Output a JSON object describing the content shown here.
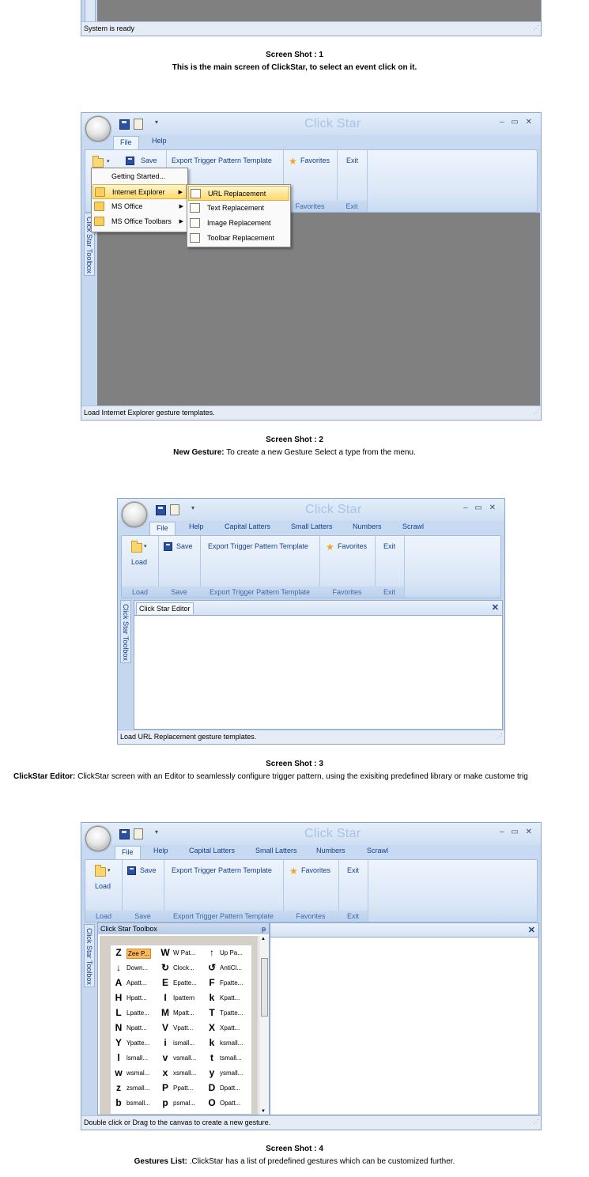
{
  "app": {
    "title": "Click Star",
    "controls": "– ▭ ✕"
  },
  "shot1": {
    "status": "System is ready",
    "caption_title": "Screen Shot : 1",
    "caption_text": "This is the main screen of ClickStar, to select an event click on it."
  },
  "shot2": {
    "tabs": [
      "File",
      "Help"
    ],
    "ribbon": {
      "save": "Save",
      "export": "Export Trigger Pattern Template",
      "favorites": "Favorites",
      "exit": "Exit",
      "group_favorites": "Favorites",
      "group_exit": "Exit"
    },
    "menu": [
      "Getting Started...",
      "Internet Explorer",
      "MS Office",
      "MS Office Toolbars"
    ],
    "submenu": [
      "URL Replacement",
      "Text Replacement",
      "Image Replacement",
      "Toolbar Replacement"
    ],
    "sidetab": "Click Star Toolbox",
    "status": "Load Internet Explorer gesture templates.",
    "caption_title": "Screen Shot : 2",
    "caption_bold": "New Gesture:",
    "caption_text": " To create a new Gesture Select a type from the menu."
  },
  "shot3": {
    "tabs": [
      "File",
      "Help",
      "Capital Latters",
      "Small Latters",
      "Numbers",
      "Scrawl"
    ],
    "ribbon": {
      "load": "Load",
      "save": "Save",
      "export": "Export Trigger Pattern Template",
      "favorites": "Favorites",
      "exit": "Exit",
      "group_load": "Load",
      "group_save": "Save",
      "group_export": "Export Trigger Pattern Template",
      "group_favorites": "Favorites",
      "group_exit": "Exit"
    },
    "sidetab": "Click Star Toolbox",
    "editor_tab": "Click Star Editor",
    "status": "Load URL Replacement gesture templates.",
    "caption_title": "Screen Shot : 3",
    "caption_bold": "ClickStar Editor:",
    "caption_text": " ClickStar screen with an Editor to seamlessly configure trigger pattern, using the exisiting predefined library or make custome trig"
  },
  "shot4": {
    "tabs": [
      "File",
      "Help",
      "Capital Latters",
      "Small Latters",
      "Numbers",
      "Scrawl"
    ],
    "ribbon": {
      "load": "Load",
      "save": "Save",
      "export": "Export Trigger Pattern Template",
      "favorites": "Favorites",
      "exit": "Exit",
      "group_load": "Load",
      "group_save": "Save",
      "group_export": "Export Trigger Pattern Template",
      "group_favorites": "Favorites",
      "group_exit": "Exit"
    },
    "sidetab": "Click Star Toolbox",
    "toolbox_title": "Click Star Toolbox",
    "pin": "ᵽ",
    "gestures": [
      [
        "Z",
        "Zee P..."
      ],
      [
        "W",
        "W Pat..."
      ],
      [
        "↑",
        "Up Pa..."
      ],
      [
        "↓",
        "Down..."
      ],
      [
        "↻",
        "Clock..."
      ],
      [
        "↺",
        "AntiCl..."
      ],
      [
        "A",
        "Apatt..."
      ],
      [
        "E",
        "Epatte..."
      ],
      [
        "F",
        "Fpatte..."
      ],
      [
        "H",
        "Hpatt..."
      ],
      [
        "I",
        "Ipattern"
      ],
      [
        "k",
        "Kpatt..."
      ],
      [
        "L",
        "Lpatte..."
      ],
      [
        "M",
        "Mpatt..."
      ],
      [
        "T",
        "Tpatte..."
      ],
      [
        "N",
        "Npatt..."
      ],
      [
        "V",
        "Vpatt..."
      ],
      [
        "X",
        "Xpatt..."
      ],
      [
        "Y",
        "Ypatte..."
      ],
      [
        "i",
        "ismall..."
      ],
      [
        "k",
        "ksmall..."
      ],
      [
        "l",
        "lsmall..."
      ],
      [
        "v",
        "vsmall..."
      ],
      [
        "t",
        "tsmall..."
      ],
      [
        "w",
        "wsmal..."
      ],
      [
        "x",
        "xsmall..."
      ],
      [
        "y",
        "ysmall..."
      ],
      [
        "z",
        "zsmall..."
      ],
      [
        "P",
        "Ppatt..."
      ],
      [
        "D",
        "Dpatt..."
      ],
      [
        "b",
        "bsmall..."
      ],
      [
        "p",
        "psmal..."
      ],
      [
        "O",
        "Opatt..."
      ]
    ],
    "status": "Double click or Drag to the canvas to create a new gesture.",
    "caption_title": "Screen Shot : 4",
    "caption_bold": "Gestures List:",
    "caption_text": " .ClickStar has a list of predefined gestures which can be customized further."
  }
}
